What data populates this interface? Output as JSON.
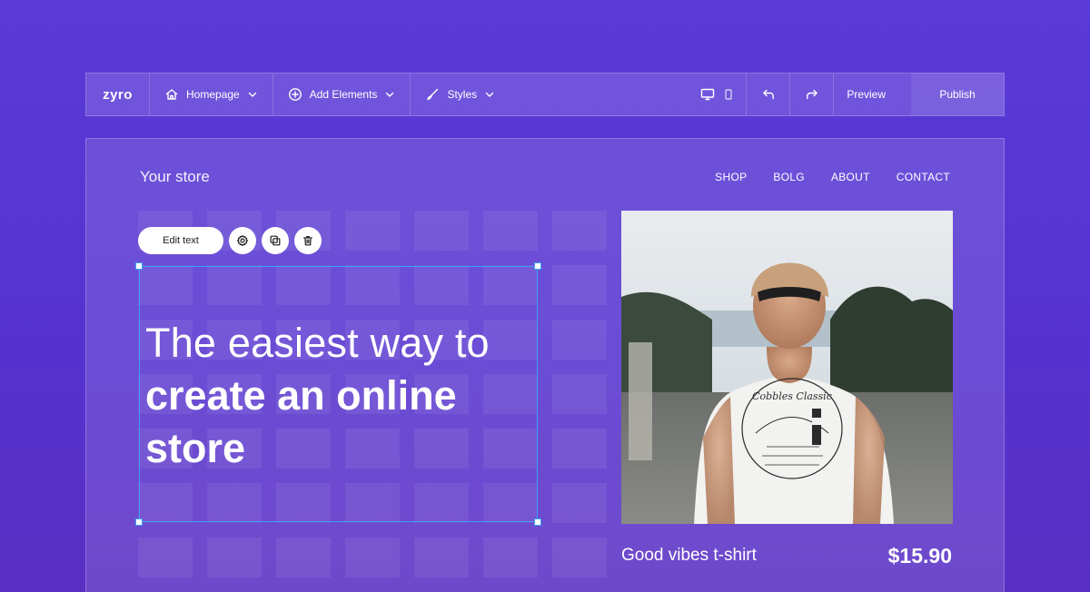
{
  "toolbar": {
    "logo": "zyro",
    "page_select": "Homepage",
    "add_elements": "Add Elements",
    "styles": "Styles",
    "preview": "Preview",
    "publish": "Publish"
  },
  "site": {
    "store_name": "Your store",
    "nav": [
      "SHOP",
      "BOLG",
      "ABOUT",
      "CONTACT"
    ]
  },
  "editor": {
    "edit_text_label": "Edit text"
  },
  "hero": {
    "line1": "The easiest way to",
    "line2": "create an online",
    "line3": "store"
  },
  "product": {
    "name": "Good vibes t-shirt",
    "price": "$15.90",
    "shirt_print": "Cobbles Classic"
  },
  "colors": {
    "background": "#5532cf",
    "selection": "#3ba0f5"
  }
}
